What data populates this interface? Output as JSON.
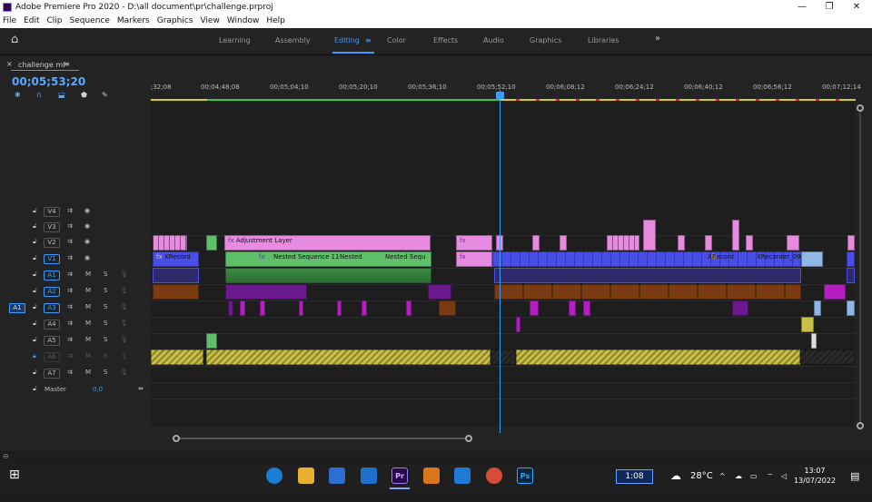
{
  "titlebar": {
    "title": "Adobe Premiere Pro 2020 - D:\\all document\\pr\\challenge.prproj",
    "minimize": "—",
    "maximize": "❐",
    "close": "✕"
  },
  "menu": [
    "File",
    "Edit",
    "Clip",
    "Sequence",
    "Markers",
    "Graphics",
    "View",
    "Window",
    "Help"
  ],
  "workspaces": {
    "home": "⌂",
    "items": [
      "Learning",
      "Assembly",
      "Editing",
      "Color",
      "Effects",
      "Audio",
      "Graphics",
      "Libraries"
    ],
    "active": "Editing",
    "more": "»",
    "menu_glyph": "≡"
  },
  "sequence": {
    "close": "×",
    "tab": "challenge ml",
    "tab_menu": "≡",
    "timecode": "00;05;53;20"
  },
  "tools": [
    "snap-icon",
    "magnet-icon",
    "marker-add-icon",
    "marker-icon",
    "wrench-icon"
  ],
  "ruler": [
    {
      "t": ";32;08"
    },
    {
      "t": "00;04;48;08"
    },
    {
      "t": "00;05;04;10"
    },
    {
      "t": "00;05;20;10"
    },
    {
      "t": "00;05;36;10"
    },
    {
      "t": "00;05;52;10"
    },
    {
      "t": "00;06;08;12"
    },
    {
      "t": "00;06;24;12"
    },
    {
      "t": "00;06;40;12"
    },
    {
      "t": "00;06;56;12"
    },
    {
      "t": "00;07;12;14"
    }
  ],
  "tracks": {
    "video": [
      "V4",
      "V3",
      "V2",
      "V1"
    ],
    "audio": [
      "A1",
      "A2",
      "A3",
      "A4",
      "A5",
      "A6",
      "A7"
    ],
    "active_video": "V1",
    "active_audio": [
      "A1",
      "A2",
      "A3"
    ],
    "source_patch": "A1",
    "m": "M",
    "s": "S",
    "master": "Master",
    "master_value": "0,0"
  },
  "clips": {
    "adjustment": "Adjustment Layer",
    "nested11": "Nested Sequence 11",
    "nested": "Nested",
    "nested_seq": "Nested Sequ",
    "xrecord1": "XRecord",
    "xrecord2": "XRecord",
    "xrecorder": "XRecorder_090",
    "fx": "fx"
  },
  "taskbar": {
    "start": "⊞",
    "search": "⌕",
    "taskview": "▭",
    "apps": [
      "edge",
      "explorer",
      "store",
      "mail",
      "premiere",
      "sublime",
      "vscode",
      "chrome",
      "photoshop"
    ],
    "premiere_label": "Pr",
    "photoshop_label": "Ps",
    "time_box": "1:08",
    "weather": "28°C",
    "clock": "13:07",
    "date": "13/07/2022",
    "tray_chevron": "^"
  },
  "colors": {
    "accent": "#3d9bff",
    "video_pink": "#e78be0",
    "video_blue": "#4a4ee8",
    "video_green": "#5fbf6a",
    "audio_yellow": "#c9bf46"
  }
}
